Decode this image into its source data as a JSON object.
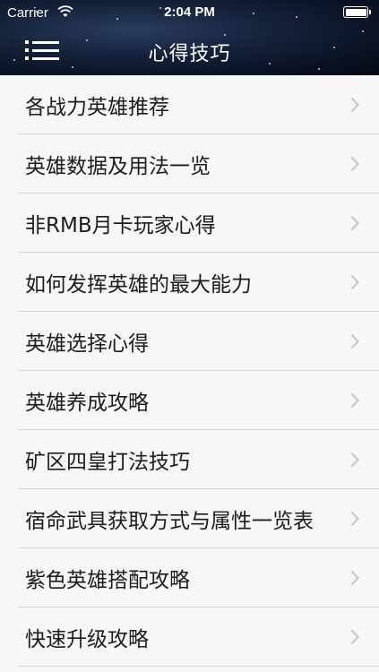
{
  "status_bar": {
    "carrier": "Carrier",
    "time": "2:04 PM",
    "wifi_icon": "wifi-icon",
    "battery_icon": "battery-full-icon"
  },
  "nav": {
    "title": "心得技巧",
    "menu_icon": "hamburger-menu-icon"
  },
  "list": {
    "items": [
      {
        "label": "各战力英雄推荐"
      },
      {
        "label": "英雄数据及用法一览"
      },
      {
        "label": "非RMB月卡玩家心得"
      },
      {
        "label": "如何发挥英雄的最大能力"
      },
      {
        "label": "英雄选择心得"
      },
      {
        "label": "英雄养成攻略"
      },
      {
        "label": "矿区四皇打法技巧"
      },
      {
        "label": "宿命武具获取方式与属性一览表"
      },
      {
        "label": "紫色英雄搭配攻略"
      },
      {
        "label": "快速升级攻略"
      }
    ],
    "chevron_icon": "chevron-right-icon"
  },
  "colors": {
    "header_bg": "#0f1a2e",
    "list_bg": "#f7f7f7",
    "separator": "#d8d8dc",
    "chevron": "#c7c7cc",
    "text": "#1c1c1c"
  }
}
